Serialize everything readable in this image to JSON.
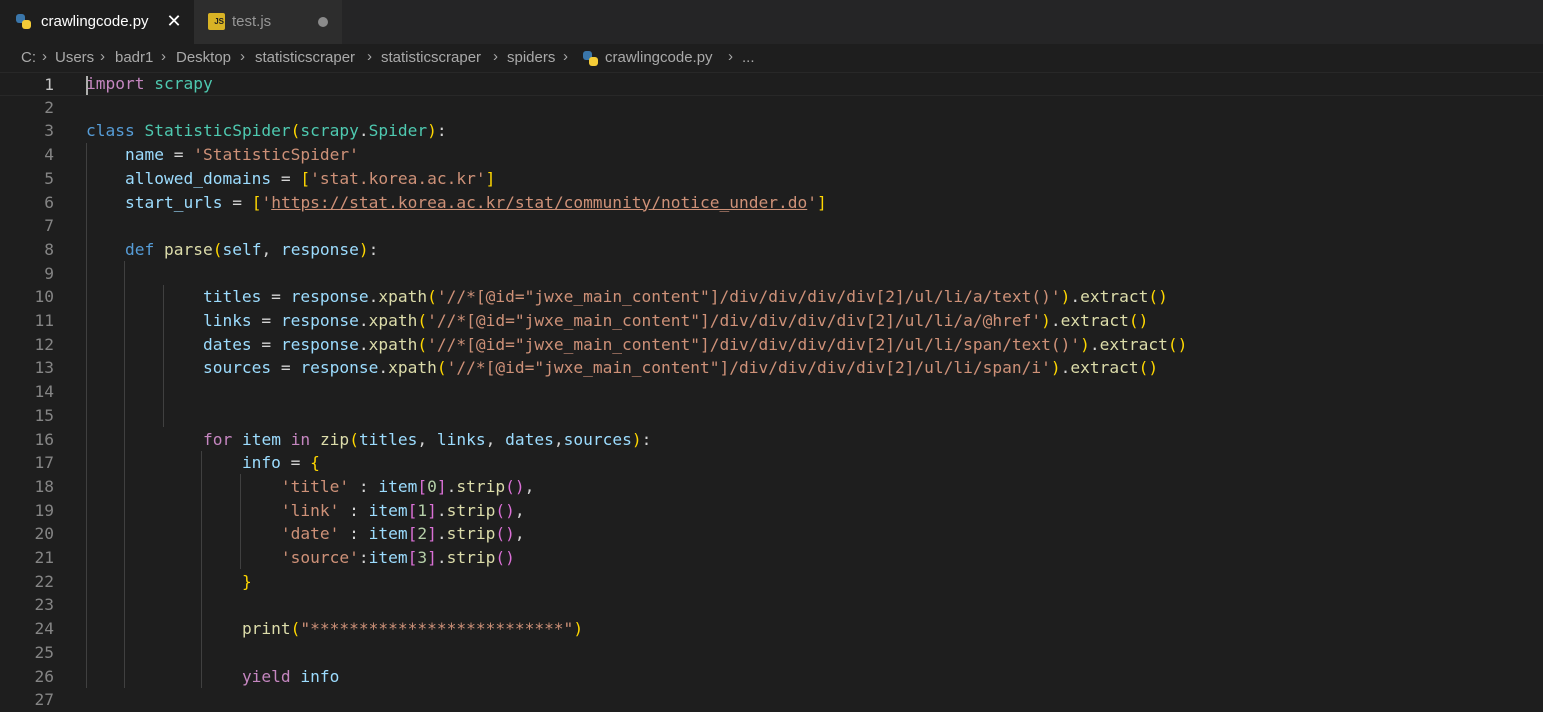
{
  "tabs": [
    {
      "label": "crawlingcode.py",
      "icon": "python-file-icon",
      "close": "✕"
    },
    {
      "label": "test.js",
      "icon": "javascript-file-icon",
      "badge": "JS"
    }
  ],
  "breadcrumb": {
    "segments": [
      "C:",
      "Users",
      "badr1",
      "Desktop",
      "statisticscraper",
      "statisticscraper",
      "spiders",
      "crawlingcode.py",
      "..."
    ],
    "separator": "›"
  },
  "editor": {
    "line_numbers": [
      "1",
      "2",
      "3",
      "4",
      "5",
      "6",
      "7",
      "8",
      "9",
      "10",
      "11",
      "12",
      "13",
      "14",
      "15",
      "16",
      "17",
      "18",
      "19",
      "20",
      "21",
      "22",
      "23",
      "24",
      "25",
      "26",
      "27"
    ],
    "current_line": 1,
    "lines": [
      [
        {
          "t": "import",
          "c": "kw"
        },
        {
          "t": " "
        },
        {
          "t": "scrapy",
          "c": "cls"
        }
      ],
      [],
      [
        {
          "t": "class",
          "c": "kb"
        },
        {
          "t": " "
        },
        {
          "t": "StatisticSpider",
          "c": "cls"
        },
        {
          "t": "(",
          "c": "p1"
        },
        {
          "t": "scrapy",
          "c": "cls"
        },
        {
          "t": "."
        },
        {
          "t": "Spider",
          "c": "cls"
        },
        {
          "t": ")",
          "c": "p1"
        },
        {
          "t": ":"
        }
      ],
      [
        {
          "t": "    "
        },
        {
          "t": "name",
          "c": "var"
        },
        {
          "t": " = "
        },
        {
          "t": "'StatisticSpider'",
          "c": "str"
        }
      ],
      [
        {
          "t": "    "
        },
        {
          "t": "allowed_domains",
          "c": "var"
        },
        {
          "t": " = "
        },
        {
          "t": "[",
          "c": "p1"
        },
        {
          "t": "'stat.korea.ac.kr'",
          "c": "str"
        },
        {
          "t": "]",
          "c": "p1"
        }
      ],
      [
        {
          "t": "    "
        },
        {
          "t": "start_urls",
          "c": "var"
        },
        {
          "t": " = "
        },
        {
          "t": "[",
          "c": "p1"
        },
        {
          "t": "'",
          "c": "str"
        },
        {
          "t": "https://stat.korea.ac.kr/stat/community/notice_under.do",
          "c": "str url"
        },
        {
          "t": "'",
          "c": "str"
        },
        {
          "t": "]",
          "c": "p1"
        }
      ],
      [],
      [
        {
          "t": "    "
        },
        {
          "t": "def",
          "c": "kb"
        },
        {
          "t": " "
        },
        {
          "t": "parse",
          "c": "fn"
        },
        {
          "t": "(",
          "c": "p1"
        },
        {
          "t": "self",
          "c": "var"
        },
        {
          "t": ", "
        },
        {
          "t": "response",
          "c": "var"
        },
        {
          "t": ")",
          "c": "p1"
        },
        {
          "t": ":"
        }
      ],
      [],
      [
        {
          "t": "            "
        },
        {
          "t": "titles",
          "c": "var"
        },
        {
          "t": " = "
        },
        {
          "t": "response",
          "c": "var"
        },
        {
          "t": "."
        },
        {
          "t": "xpath",
          "c": "fn"
        },
        {
          "t": "(",
          "c": "p1"
        },
        {
          "t": "'//*[@id=\"jwxe_main_content\"]/div/div/div/div[2]/ul/li/a/text()'",
          "c": "str"
        },
        {
          "t": ")",
          "c": "p1"
        },
        {
          "t": "."
        },
        {
          "t": "extract",
          "c": "fn"
        },
        {
          "t": "()",
          "c": "p1"
        }
      ],
      [
        {
          "t": "            "
        },
        {
          "t": "links",
          "c": "var"
        },
        {
          "t": " = "
        },
        {
          "t": "response",
          "c": "var"
        },
        {
          "t": "."
        },
        {
          "t": "xpath",
          "c": "fn"
        },
        {
          "t": "(",
          "c": "p1"
        },
        {
          "t": "'//*[@id=\"jwxe_main_content\"]/div/div/div/div[2]/ul/li/a/@href'",
          "c": "str"
        },
        {
          "t": ")",
          "c": "p1"
        },
        {
          "t": "."
        },
        {
          "t": "extract",
          "c": "fn"
        },
        {
          "t": "()",
          "c": "p1"
        }
      ],
      [
        {
          "t": "            "
        },
        {
          "t": "dates",
          "c": "var"
        },
        {
          "t": " = "
        },
        {
          "t": "response",
          "c": "var"
        },
        {
          "t": "."
        },
        {
          "t": "xpath",
          "c": "fn"
        },
        {
          "t": "(",
          "c": "p1"
        },
        {
          "t": "'//*[@id=\"jwxe_main_content\"]/div/div/div/div[2]/ul/li/span/text()'",
          "c": "str"
        },
        {
          "t": ")",
          "c": "p1"
        },
        {
          "t": "."
        },
        {
          "t": "extract",
          "c": "fn"
        },
        {
          "t": "()",
          "c": "p1"
        }
      ],
      [
        {
          "t": "            "
        },
        {
          "t": "sources",
          "c": "var"
        },
        {
          "t": " = "
        },
        {
          "t": "response",
          "c": "var"
        },
        {
          "t": "."
        },
        {
          "t": "xpath",
          "c": "fn"
        },
        {
          "t": "(",
          "c": "p1"
        },
        {
          "t": "'//*[@id=\"jwxe_main_content\"]/div/div/div/div[2]/ul/li/span/i'",
          "c": "str"
        },
        {
          "t": ")",
          "c": "p1"
        },
        {
          "t": "."
        },
        {
          "t": "extract",
          "c": "fn"
        },
        {
          "t": "()",
          "c": "p1"
        }
      ],
      [],
      [],
      [
        {
          "t": "            "
        },
        {
          "t": "for",
          "c": "kw"
        },
        {
          "t": " "
        },
        {
          "t": "item",
          "c": "var"
        },
        {
          "t": " "
        },
        {
          "t": "in",
          "c": "kw"
        },
        {
          "t": " "
        },
        {
          "t": "zip",
          "c": "fn"
        },
        {
          "t": "(",
          "c": "p1"
        },
        {
          "t": "titles",
          "c": "var"
        },
        {
          "t": ", "
        },
        {
          "t": "links",
          "c": "var"
        },
        {
          "t": ", "
        },
        {
          "t": "dates",
          "c": "var"
        },
        {
          "t": ","
        },
        {
          "t": "sources",
          "c": "var"
        },
        {
          "t": ")",
          "c": "p1"
        },
        {
          "t": ":"
        }
      ],
      [
        {
          "t": "                "
        },
        {
          "t": "info",
          "c": "var"
        },
        {
          "t": " = "
        },
        {
          "t": "{",
          "c": "p1"
        }
      ],
      [
        {
          "t": "                    "
        },
        {
          "t": "'title'",
          "c": "str"
        },
        {
          "t": " : "
        },
        {
          "t": "item",
          "c": "var"
        },
        {
          "t": "[",
          "c": "p2"
        },
        {
          "t": "0",
          "c": "num"
        },
        {
          "t": "]",
          "c": "p2"
        },
        {
          "t": "."
        },
        {
          "t": "strip",
          "c": "fn"
        },
        {
          "t": "()",
          "c": "p2"
        },
        {
          "t": ","
        }
      ],
      [
        {
          "t": "                    "
        },
        {
          "t": "'link'",
          "c": "str"
        },
        {
          "t": " : "
        },
        {
          "t": "item",
          "c": "var"
        },
        {
          "t": "[",
          "c": "p2"
        },
        {
          "t": "1",
          "c": "num"
        },
        {
          "t": "]",
          "c": "p2"
        },
        {
          "t": "."
        },
        {
          "t": "strip",
          "c": "fn"
        },
        {
          "t": "()",
          "c": "p2"
        },
        {
          "t": ","
        }
      ],
      [
        {
          "t": "                    "
        },
        {
          "t": "'date'",
          "c": "str"
        },
        {
          "t": " : "
        },
        {
          "t": "item",
          "c": "var"
        },
        {
          "t": "[",
          "c": "p2"
        },
        {
          "t": "2",
          "c": "num"
        },
        {
          "t": "]",
          "c": "p2"
        },
        {
          "t": "."
        },
        {
          "t": "strip",
          "c": "fn"
        },
        {
          "t": "()",
          "c": "p2"
        },
        {
          "t": ","
        }
      ],
      [
        {
          "t": "                    "
        },
        {
          "t": "'source'",
          "c": "str"
        },
        {
          "t": ":"
        },
        {
          "t": "item",
          "c": "var"
        },
        {
          "t": "[",
          "c": "p2"
        },
        {
          "t": "3",
          "c": "num"
        },
        {
          "t": "]",
          "c": "p2"
        },
        {
          "t": "."
        },
        {
          "t": "strip",
          "c": "fn"
        },
        {
          "t": "()",
          "c": "p2"
        }
      ],
      [
        {
          "t": "                "
        },
        {
          "t": "}",
          "c": "p1"
        }
      ],
      [],
      [
        {
          "t": "                "
        },
        {
          "t": "print",
          "c": "fn"
        },
        {
          "t": "(",
          "c": "p1"
        },
        {
          "t": "\"**************************\"",
          "c": "str"
        },
        {
          "t": ")",
          "c": "p1"
        }
      ],
      [],
      [
        {
          "t": "                "
        },
        {
          "t": "yield",
          "c": "kw"
        },
        {
          "t": " "
        },
        {
          "t": "info",
          "c": "var"
        }
      ],
      []
    ]
  }
}
